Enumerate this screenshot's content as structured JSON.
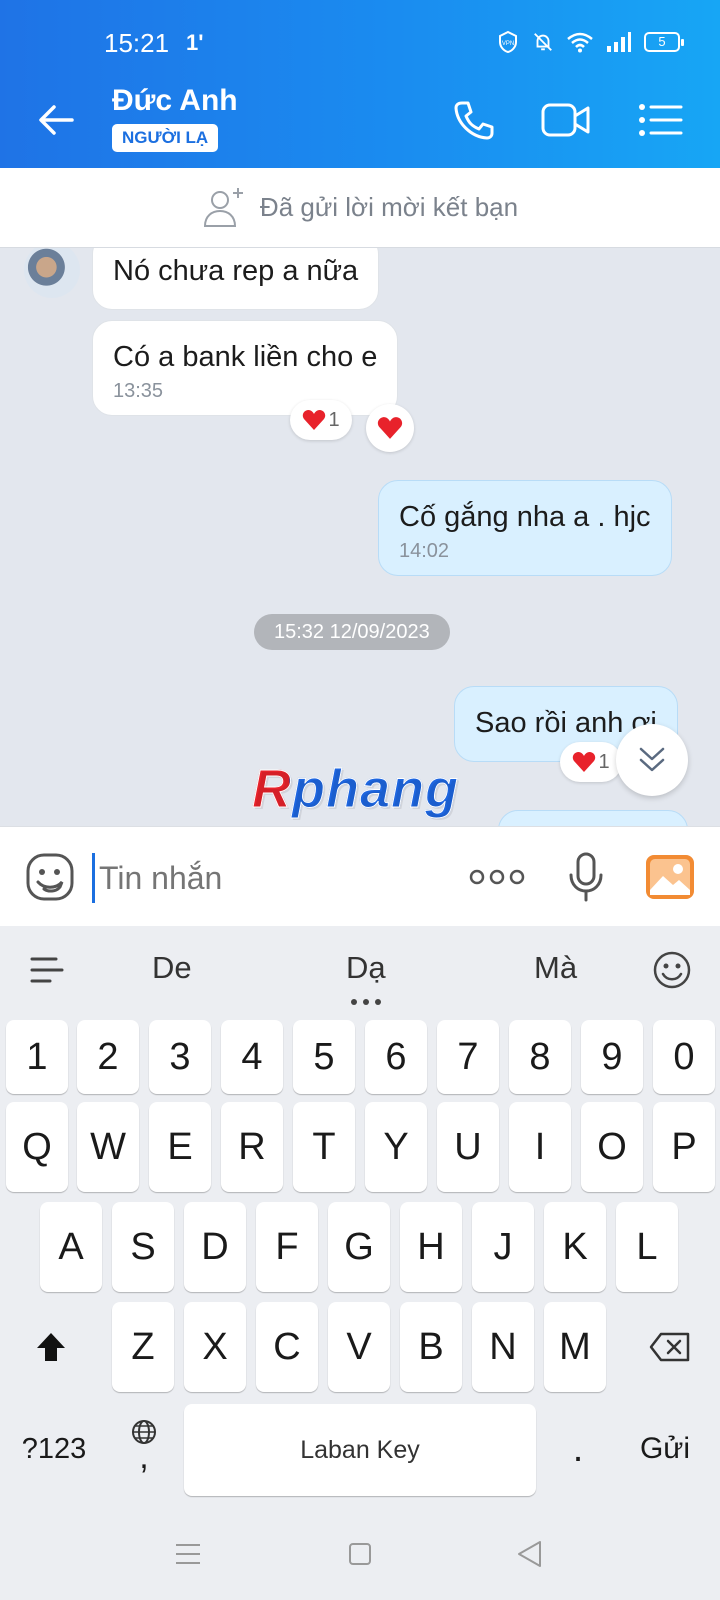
{
  "status_bar": {
    "time": "15:21",
    "indicator": "1'",
    "battery": "5"
  },
  "header": {
    "contact_name": "Đức Anh",
    "badge": "NGƯỜI LẠ"
  },
  "friend_request": {
    "text": "Đã gửi lời mời kết bạn"
  },
  "messages": {
    "m1": {
      "text": "Nó chưa rep a nữa"
    },
    "m2": {
      "text": "Có a bank liền cho e",
      "time": "13:35",
      "reaction_count": "1"
    },
    "m3": {
      "text": "Cố gắng nha a . hjc",
      "time": "14:02"
    },
    "date_separator": "15:32 12/09/2023",
    "m4": {
      "text": "Sao rồi anh ơi",
      "reaction_count": "1"
    }
  },
  "watermark": "Rphang",
  "composer": {
    "placeholder": "Tin nhắn"
  },
  "keyboard": {
    "suggestions": [
      "De",
      "Dạ",
      "Mà"
    ],
    "row_numbers": [
      "1",
      "2",
      "3",
      "4",
      "5",
      "6",
      "7",
      "8",
      "9",
      "0"
    ],
    "row1": [
      "Q",
      "W",
      "E",
      "R",
      "T",
      "Y",
      "U",
      "I",
      "O",
      "P"
    ],
    "row2": [
      "A",
      "S",
      "D",
      "F",
      "G",
      "H",
      "J",
      "K",
      "L"
    ],
    "row3": [
      "Z",
      "X",
      "C",
      "V",
      "B",
      "N",
      "M"
    ],
    "symbols_label": "?123",
    "comma": ",",
    "space_label": "Laban Key",
    "period": ".",
    "send_label": "Gửi"
  },
  "colors": {
    "brand_blue": "#1b6fe0",
    "outgoing_bubble": "#d9f0ff",
    "reaction_heart": "#e8222b"
  }
}
